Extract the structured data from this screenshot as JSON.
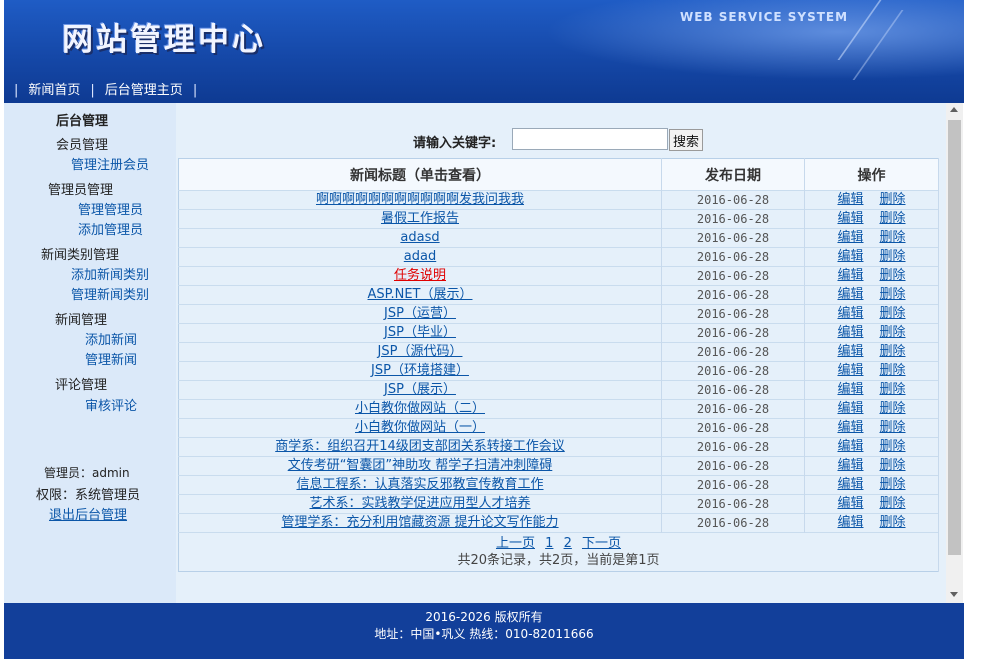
{
  "header": {
    "site_title": "网站管理中心",
    "subtitle": "WEB SERVICE SYSTEM",
    "nav": [
      {
        "label": "新闻首页"
      },
      {
        "label": "后台管理主页"
      }
    ]
  },
  "sidebar": {
    "title": "后台管理",
    "member_mgmt": "会员管理",
    "manage_registered_members": "管理注册会员",
    "admin_mgmt": "管理员管理",
    "manage_admins": "管理管理员",
    "add_admin": "添加管理员",
    "news_category_mgmt": "新闻类别管理",
    "add_news_category": "添加新闻类别",
    "manage_news_category": "管理新闻类别",
    "news_mgmt": "新闻管理",
    "add_news": "添加新闻",
    "manage_news": "管理新闻",
    "comment_mgmt": "评论管理",
    "review_comments": "审核评论",
    "admin_user": "管理员：admin",
    "permission": "权限：系统管理员",
    "logout": "退出后台管理"
  },
  "search": {
    "label": "请输入关键字:",
    "value": "",
    "button": "搜索"
  },
  "table": {
    "headers": [
      "新闻标题（单击查看）",
      "发布日期",
      "操作"
    ],
    "edit_label": "编辑",
    "delete_label": "删除",
    "rows": [
      {
        "title": "啊啊啊啊啊啊啊啊啊啊啊发我问我我",
        "date": "2016-06-28"
      },
      {
        "title": "暑假工作报告",
        "date": "2016-06-28"
      },
      {
        "title": "adasd",
        "date": "2016-06-28"
      },
      {
        "title": "adad",
        "date": "2016-06-28"
      },
      {
        "title": "任务说明",
        "date": "2016-06-28",
        "highlight": "#e00000"
      },
      {
        "title": "ASP.NET（展示）",
        "date": "2016-06-28"
      },
      {
        "title": "JSP（运营）",
        "date": "2016-06-28"
      },
      {
        "title": "JSP（毕业）",
        "date": "2016-06-28"
      },
      {
        "title": "JSP（源代码）",
        "date": "2016-06-28"
      },
      {
        "title": "JSP（环境搭建）",
        "date": "2016-06-28"
      },
      {
        "title": "JSP（展示）",
        "date": "2016-06-28"
      },
      {
        "title": "小白教你做网站（二）",
        "date": "2016-06-28"
      },
      {
        "title": "小白教你做网站（一）",
        "date": "2016-06-28"
      },
      {
        "title": "商学系：组织召开14级团支部团关系转接工作会议",
        "date": "2016-06-28"
      },
      {
        "title": "文传考研“智囊团”神助攻 帮学子扫清冲刺障碍",
        "date": "2016-06-28"
      },
      {
        "title": "信息工程系：认真落实反邪教宣传教育工作",
        "date": "2016-06-28"
      },
      {
        "title": "艺术系：实践教学促进应用型人才培养",
        "date": "2016-06-28"
      },
      {
        "title": "管理学系：充分利用馆藏资源 提升论文写作能力",
        "date": "2016-06-28"
      }
    ]
  },
  "pager": {
    "prev": "上一页",
    "page1": "1",
    "page2": "2",
    "next": "下一页",
    "info": "共20条记录，共2页，当前是第1页"
  },
  "footer": {
    "copyright": "2016-2026 版权所有",
    "address": "地址：中国•巩义 热线：010-82011666"
  },
  "colors": {
    "header_blue": "#1548a8",
    "sidebar_bg": "#dbe9f9",
    "main_bg": "#e5f0fa",
    "link": "#0b56a8",
    "footer_blue": "#123f9a"
  }
}
